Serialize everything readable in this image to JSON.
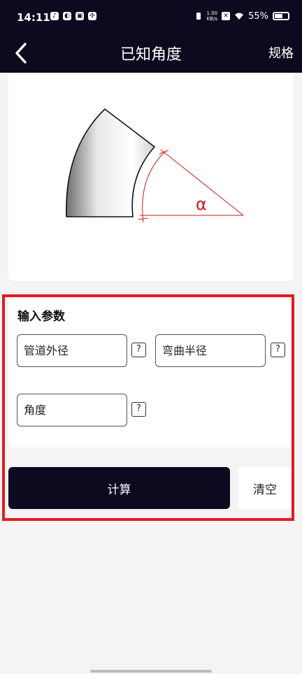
{
  "status_bar": {
    "time": "14:11",
    "network_speed_value": "1.00",
    "network_speed_unit": "KB/s",
    "battery": "55%"
  },
  "nav": {
    "title": "已知角度",
    "right_label": "规格"
  },
  "diagram": {
    "angle_symbol": "α",
    "accent_color": "#d11a1a"
  },
  "params": {
    "title": "输入参数",
    "outer_diameter_placeholder": "管道外径",
    "bend_radius_placeholder": "弯曲半径",
    "angle_placeholder": "角度",
    "help_label": "?"
  },
  "actions": {
    "calculate_label": "计算",
    "clear_label": "清空"
  },
  "colors": {
    "header_bg": "#0b0a1e",
    "highlight_border": "#e11b22",
    "page_bg": "#f4f4f4"
  }
}
